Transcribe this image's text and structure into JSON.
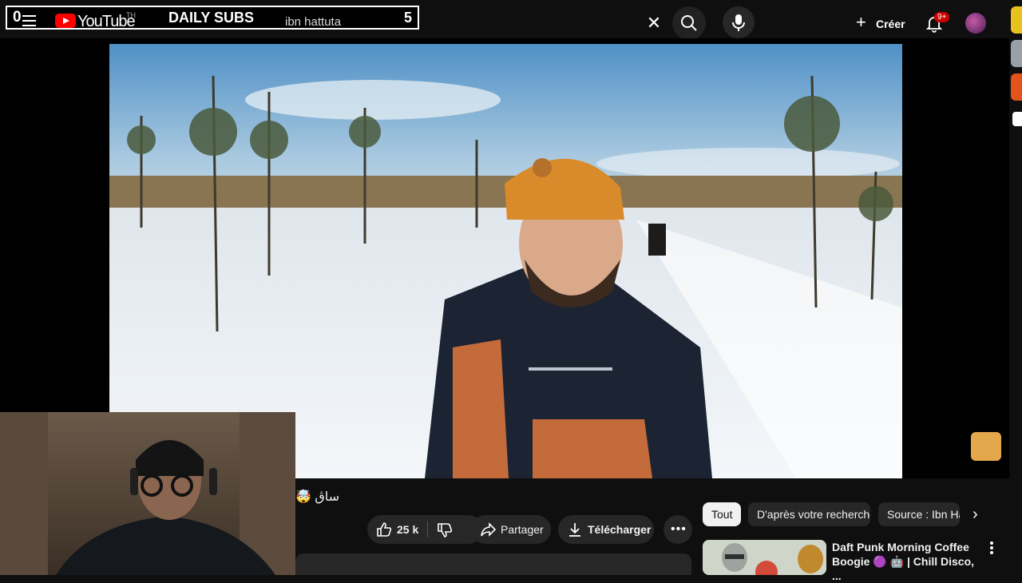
{
  "overlay": {
    "count_left": "0",
    "title": "DAILY SUBS",
    "search_text": "ibn hattuta",
    "count_right": "5"
  },
  "header": {
    "logo_text": "YouTube",
    "country_code": "TH",
    "create_label": "Créer",
    "notifications_badge": "9+"
  },
  "video": {
    "title_fragment": "ساڨ 🤯"
  },
  "actions": {
    "like_count": "25 k",
    "share_label": "Partager",
    "download_label": "Télécharger"
  },
  "sidebar": {
    "chips": [
      "Tout",
      "D'après votre recherche",
      "Source : Ibn Hattuta"
    ],
    "recommendation": {
      "title": "Daft Punk Morning Coffee Boogie 🟣 🤖 | Chill Disco, ..."
    }
  },
  "colors": {
    "background": "#0f0f0f",
    "surface": "#272727",
    "brand_red": "#ff0000",
    "badge_red": "#cc0000",
    "chip_active": "#f1f1f1"
  }
}
